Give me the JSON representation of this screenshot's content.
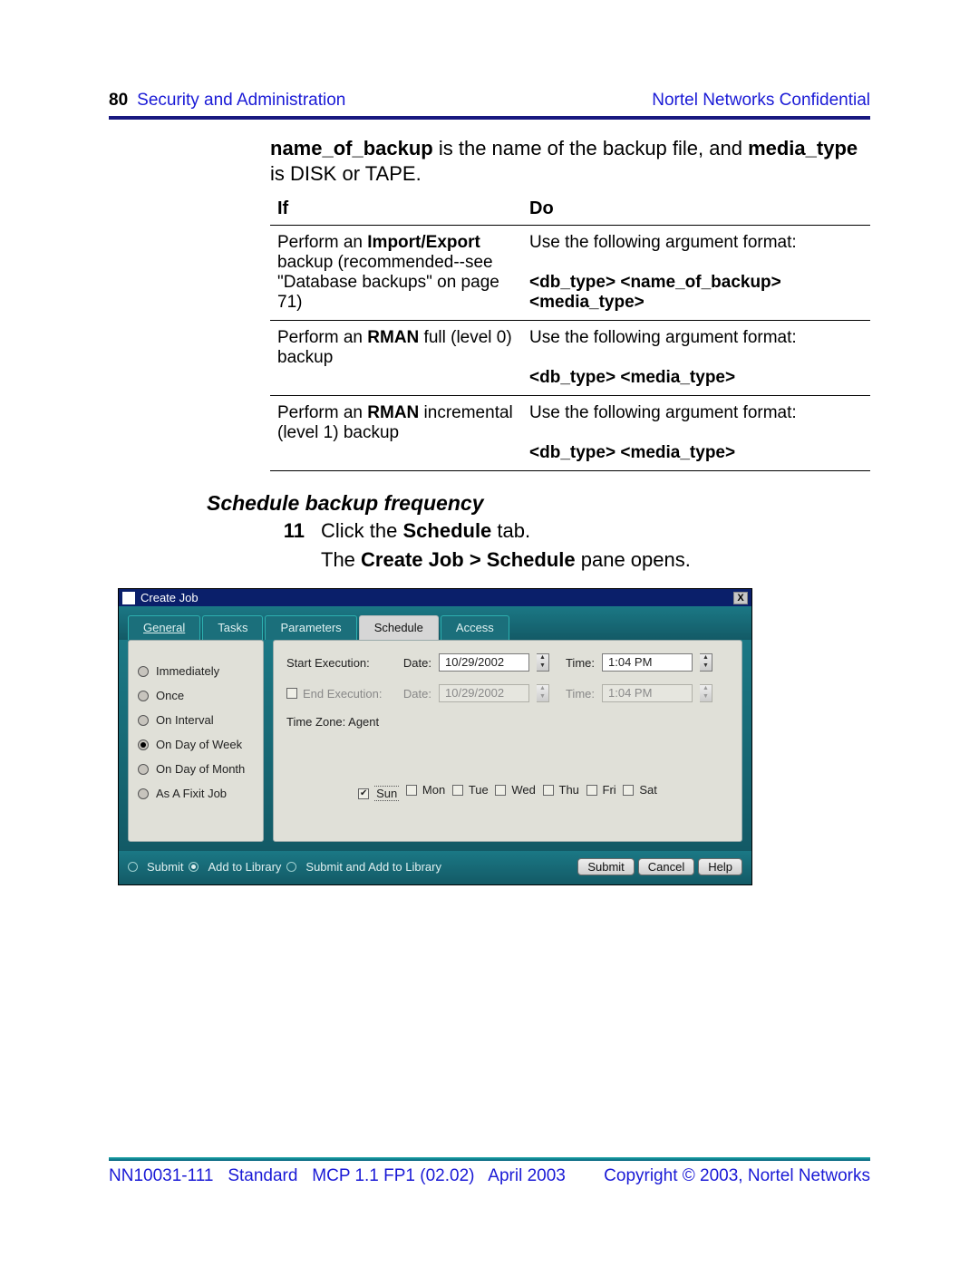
{
  "header": {
    "page_number": "80",
    "section": "Security and Administration",
    "confidential": "Nortel Networks Confidential"
  },
  "intro": {
    "b1": "name_of_backup",
    "t1": " is the name of the backup file, and ",
    "b2": "media_type",
    "t2": " is DISK or TAPE."
  },
  "table": {
    "head_if": "If",
    "head_do": "Do",
    "rows": [
      {
        "if_pre": "Perform an ",
        "if_bold": "Import/Export",
        "if_post": " backup (recommended--see \"Database backups\" on page 71)",
        "do_line": "Use the following argument format:",
        "do_bold": "<db_type> <name_of_backup> <media_type>"
      },
      {
        "if_pre": "Perform an ",
        "if_bold": "RMAN",
        "if_post": " full (level 0) backup",
        "do_line": "Use the following argument format:",
        "do_bold": "<db_type> <media_type>"
      },
      {
        "if_pre": "Perform an ",
        "if_bold": "RMAN",
        "if_post": " incremental (level 1) backup",
        "do_line": "Use the following argument format:",
        "do_bold": "<db_type> <media_type>"
      }
    ]
  },
  "heading": "Schedule backup frequency",
  "step": {
    "num": "11",
    "pre": "Click the ",
    "bold": "Schedule",
    "post": " tab."
  },
  "after": {
    "pre": "The ",
    "bold": "Create Job > Schedule",
    "post": " pane opens."
  },
  "dialog": {
    "title": "Create Job",
    "close": "X",
    "tabs": {
      "general": "General",
      "tasks": "Tasks",
      "parameters": "Parameters",
      "schedule": "Schedule",
      "access": "Access"
    },
    "freq": {
      "immediately": "Immediately",
      "once": "Once",
      "interval": "On Interval",
      "dow": "On Day of Week",
      "dom": "On Day of Month",
      "fixit": "As A Fixit Job"
    },
    "form": {
      "start_label": "Start Execution:",
      "end_label": "End Execution:",
      "date_label": "Date:",
      "time_label": "Time:",
      "start_date": "10/29/2002",
      "start_time": "1:04 PM",
      "end_date": "10/29/2002",
      "end_time": "1:04 PM",
      "tz": "Time Zone: Agent"
    },
    "days": {
      "sun": "Sun",
      "mon": "Mon",
      "tue": "Tue",
      "wed": "Wed",
      "thu": "Thu",
      "fri": "Fri",
      "sat": "Sat"
    },
    "bottom": {
      "submit_radio": "Submit",
      "add_lib": "Add to Library",
      "both": "Submit and Add to Library",
      "btn_submit": "Submit",
      "btn_cancel": "Cancel",
      "btn_help": "Help"
    }
  },
  "footer": {
    "left1": "NN10031-111",
    "left2": "Standard",
    "left3": "MCP 1.1 FP1 (02.02)",
    "left4": "April 2003",
    "right": "Copyright © 2003, Nortel Networks"
  }
}
